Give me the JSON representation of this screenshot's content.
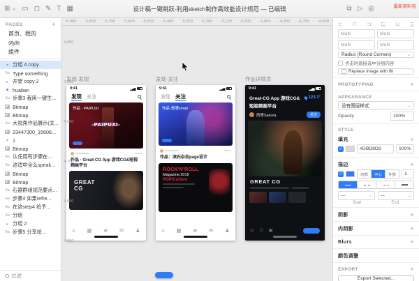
{
  "toolbar": {
    "title": "设计稿一键跳跃-利用sketch制作高效能设计规范 — 已编辑",
    "watermark": "最新资料包"
  },
  "sidebar": {
    "pages_header": "PAGES",
    "pages": [
      {
        "label": "首页、我的"
      },
      {
        "label": "style"
      },
      {
        "label": "组件"
      }
    ],
    "layers": [
      {
        "icon": "group-open",
        "label": "分组 4 copy",
        "selected": true
      },
      {
        "icon": "text",
        "label": "Type something"
      },
      {
        "icon": "group",
        "label": "开架 copy 2"
      },
      {
        "icon": "symbol",
        "label": "huaban"
      },
      {
        "icon": "text",
        "label": "步骤3 我用一键生..."
      },
      {
        "icon": "image",
        "label": "Bitmap"
      },
      {
        "icon": "image",
        "label": "Bitmap"
      },
      {
        "icon": "text",
        "label": "大视角作品展示(关..."
      },
      {
        "icon": "image",
        "label": "23447300_15606..."
      },
      {
        "icon": "group-open",
        "label": "1"
      },
      {
        "icon": "image",
        "label": "Bitmap"
      },
      {
        "icon": "text",
        "label": "认任用有步骤在..."
      },
      {
        "icon": "text",
        "label": "这适中全么speak..."
      },
      {
        "icon": "image",
        "label": "Bitmap"
      },
      {
        "icon": "image",
        "label": "Bitmap"
      },
      {
        "icon": "text",
        "label": "石器群组规范要点..."
      },
      {
        "icon": "text",
        "label": "步骤4 如果refre..."
      },
      {
        "icon": "text",
        "label": "在这step4 给予..."
      },
      {
        "icon": "text",
        "label": "分组"
      },
      {
        "icon": "group",
        "label": "分组 2"
      },
      {
        "icon": "text",
        "label": "步骤5 分享给..."
      }
    ],
    "filter_label": "过滤"
  },
  "canvas": {
    "h_ruler": [
      "-5,900",
      "-5,800",
      "-5,700",
      "-5,600",
      "-5,500",
      "-5,400",
      "-5,300",
      "-5,200",
      "-5,100",
      "-5,000",
      "-4,900",
      "-4,800",
      "-4,700",
      "-4,600"
    ],
    "v_ruler": [
      "4,400",
      "4,500",
      "4,600",
      "4,700",
      "4,800",
      "4,900"
    ],
    "artboards": [
      {
        "title": "发现·发现",
        "time": "9:41",
        "tab1": "发现",
        "tab2": "关注",
        "card1_overlay": "作品 · PAIPUXI",
        "card1_center": "-PAIPUXI-",
        "card2_title": "作品 · Great-CG App 游戏CG&短视频画平台",
        "brand_line1": "GREAT",
        "brand_line2": "CG"
      },
      {
        "title": "发现·关注",
        "time": "9:41",
        "tab1": "发现",
        "tab2": "关注",
        "card1_overlay": "作品·想漫small",
        "card2_title": "作品：滨石杂志page设计",
        "mag_line1": "ROCK'N'ROLL",
        "mag_line2": "Magazine:2019",
        "mag_line3": "POP/Culture"
      },
      {
        "title": "作品详情页",
        "time": "9:41",
        "heat": "123.3°",
        "app_title": "Great-CG App 游戏CG&",
        "app_subtitle": "短视频画平台",
        "author": "西哥Sakura",
        "follow": "关注",
        "brand": "GREAT CG"
      }
    ]
  },
  "inspector": {
    "pos_x": "Multi",
    "pos_y": "Multi",
    "pos_w": "Multi",
    "pos_h": "Multi",
    "radius_label": "Radius (Round Corners)",
    "click_label": "点击时直接选中分组内容",
    "replace_label": "Replace Image with fill",
    "prototyping_header": "PROTOTYPING",
    "appearance_header": "APPEARANCE",
    "layer_style": "没有图层样式",
    "opacity_label": "Opacity",
    "opacity_value": "100%",
    "style_header": "STYLE",
    "fills_header": "填充",
    "fill_hex": "#DBD8D8",
    "fill_opacity": "100%",
    "borders_header": "描边",
    "border_pos": [
      "内部",
      "中心",
      "外部"
    ],
    "border_weight": "1",
    "start_label": "Start",
    "end_label": "End",
    "shadows_header": "阴影",
    "inner_shadows_header": "内阴影",
    "blurs_header": "Blurs",
    "color_adjust_header": "颜色调整",
    "export_header": "EXPORT",
    "export_button": "Export Selected...",
    "accent_color": "#2F7CF6",
    "fill_swatch_color": "#DBD8D8"
  }
}
